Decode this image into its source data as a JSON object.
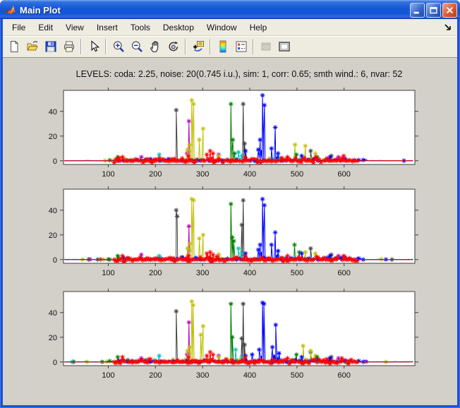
{
  "window": {
    "title": "Main Plot",
    "controls": [
      {
        "name": "minimize-button",
        "icon": "minimize-icon"
      },
      {
        "name": "maximize-button",
        "icon": "maximize-icon"
      },
      {
        "name": "close-button",
        "icon": "close-icon"
      }
    ]
  },
  "menu": {
    "items": [
      "File",
      "Edit",
      "View",
      "Insert",
      "Tools",
      "Desktop",
      "Window",
      "Help"
    ]
  },
  "toolbar": {
    "buttons": [
      {
        "name": "new-figure-button",
        "icon": "new-document-icon"
      },
      {
        "name": "open-file-button",
        "icon": "open-folder-icon"
      },
      {
        "name": "save-figure-button",
        "icon": "save-icon"
      },
      {
        "name": "print-figure-button",
        "icon": "print-icon"
      },
      {
        "separator": true
      },
      {
        "name": "edit-plot-button",
        "icon": "pointer-arrow-icon"
      },
      {
        "separator": true
      },
      {
        "name": "zoom-in-button",
        "icon": "zoom-in-icon"
      },
      {
        "name": "zoom-out-button",
        "icon": "zoom-out-icon"
      },
      {
        "name": "pan-button",
        "icon": "hand-icon"
      },
      {
        "name": "rotate-3d-button",
        "icon": "rotate-3d-icon"
      },
      {
        "separator": true
      },
      {
        "name": "data-cursor-button",
        "icon": "data-cursor-icon"
      },
      {
        "separator": true
      },
      {
        "name": "insert-colorbar-button",
        "icon": "colorbar-icon"
      },
      {
        "name": "insert-legend-button",
        "icon": "legend-icon"
      },
      {
        "separator": true
      },
      {
        "name": "hide-plot-tools-button",
        "icon": "hide-plot-tools-icon",
        "disabled": true
      },
      {
        "name": "show-plot-tools-button",
        "icon": "show-plot-tools-icon"
      }
    ]
  },
  "chart_data": {
    "type": "line",
    "title": "LEVELS: coda: 2.25, noise: 20(0.745 i.u.), sim: 1, corr: 0.65; smth wind.: 6, nvar: 52",
    "xlabel": "",
    "ylabel": "",
    "xlim": [
      5,
      750
    ],
    "ylim": [
      -3,
      57
    ],
    "xticks": [
      100,
      200,
      300,
      400,
      500,
      600
    ],
    "yticks": [
      0,
      20,
      40
    ],
    "grid": false,
    "legend": "none",
    "marker": "*",
    "series_order": [
      "gray",
      "magenta",
      "yellow",
      "green",
      "cyan",
      "blue",
      "red"
    ],
    "colors": {
      "gray": "#404040",
      "magenta": "#bf00bf",
      "yellow": "#bfbf00",
      "green": "#008000",
      "cyan": "#00bfbf",
      "blue": "#0000ff",
      "red": "#ff0000"
    },
    "noise": {
      "gray": {
        "band": [
          110,
          620
        ],
        "amp": 1.0,
        "base": 0.25,
        "every": 8
      },
      "magenta": {
        "band": [
          120,
          620
        ],
        "amp": 1.6,
        "base": 0.25,
        "every": 6
      },
      "yellow": {
        "band": [
          120,
          610
        ],
        "amp": 2.2,
        "base": 0.25,
        "every": 4
      },
      "green": {
        "band": [
          100,
          600
        ],
        "amp": 1.4,
        "base": 0.25,
        "every": 6
      },
      "cyan": {
        "band": [
          130,
          580
        ],
        "amp": 1.4,
        "base": 0.2,
        "every": 6
      },
      "blue": {
        "band": [
          120,
          650
        ],
        "amp": 2.0,
        "base": 0.3,
        "every": 3
      },
      "red": {
        "band": [
          110,
          630
        ],
        "amp": 2.4,
        "base": 0.25,
        "every": 1,
        "neg": true
      }
    },
    "subplots": [
      {
        "peaks": {
          "gray": [
            [
              244,
              41
            ],
            [
              386,
              46
            ],
            [
              389,
              14
            ],
            [
              529,
              8
            ],
            [
              573,
              4
            ]
          ],
          "magenta": [
            [
              271,
              32
            ],
            [
              267,
              6
            ],
            [
              334,
              5
            ],
            [
              170,
              3
            ],
            [
              588,
              3
            ]
          ],
          "yellow": [
            [
              268,
              9
            ],
            [
              273,
              13
            ],
            [
              277,
              49
            ],
            [
              281,
              46
            ],
            [
              293,
              17
            ],
            [
              301,
              26
            ],
            [
              334,
              4
            ],
            [
              496,
              13
            ],
            [
              518,
              12
            ],
            [
              539,
              6
            ]
          ],
          "green": [
            [
              120,
              3
            ],
            [
              360,
              46
            ],
            [
              364,
              17
            ],
            [
              368,
              6
            ],
            [
              499,
              5
            ],
            [
              543,
              3
            ]
          ],
          "cyan": [
            [
              208,
              5
            ],
            [
              376,
              7
            ],
            [
              383,
              4
            ],
            [
              460,
              3
            ]
          ],
          "blue": [
            [
              391,
              8
            ],
            [
              418,
              9
            ],
            [
              422,
              17
            ],
            [
              427,
              53
            ],
            [
              431,
              45
            ],
            [
              446,
              10
            ],
            [
              454,
              27
            ],
            [
              460,
              6
            ],
            [
              510,
              4
            ],
            [
              570,
              3
            ]
          ],
          "red": [
            [
              130,
              3
            ],
            [
              270,
              4
            ],
            [
              309,
              5
            ],
            [
              316,
              8
            ],
            [
              322,
              6
            ],
            [
              390,
              3
            ],
            [
              480,
              3
            ],
            [
              540,
              3
            ],
            [
              599,
              4
            ]
          ]
        }
      },
      {
        "peaks": {
          "gray": [
            [
              244,
              40
            ],
            [
              246,
              35
            ],
            [
              383,
              28
            ],
            [
              386,
              48
            ],
            [
              529,
              9
            ],
            [
              573,
              4
            ]
          ],
          "magenta": [
            [
              271,
              27
            ],
            [
              170,
              4
            ],
            [
              334,
              4
            ],
            [
              588,
              3
            ]
          ],
          "yellow": [
            [
              268,
              9
            ],
            [
              273,
              13
            ],
            [
              277,
              49
            ],
            [
              281,
              48
            ],
            [
              293,
              17
            ],
            [
              301,
              20
            ],
            [
              334,
              4
            ],
            [
              518,
              6
            ],
            [
              539,
              5
            ]
          ],
          "green": [
            [
              120,
              3
            ],
            [
              360,
              45
            ],
            [
              363,
              18
            ],
            [
              366,
              15
            ],
            [
              495,
              12
            ],
            [
              505,
              6
            ]
          ],
          "cyan": [
            [
              208,
              3
            ],
            [
              376,
              9
            ],
            [
              383,
              5
            ],
            [
              460,
              3
            ]
          ],
          "blue": [
            [
              391,
              5
            ],
            [
              418,
              8
            ],
            [
              422,
              12
            ],
            [
              427,
              49
            ],
            [
              431,
              44
            ],
            [
              446,
              12
            ],
            [
              454,
              22
            ],
            [
              460,
              7
            ],
            [
              510,
              5
            ],
            [
              570,
              3
            ]
          ],
          "red": [
            [
              130,
              3
            ],
            [
              270,
              3
            ],
            [
              309,
              5
            ],
            [
              316,
              6
            ],
            [
              322,
              4
            ],
            [
              390,
              3
            ],
            [
              480,
              3
            ],
            [
              599,
              3
            ]
          ]
        }
      },
      {
        "peaks": {
          "gray": [
            [
              244,
              41
            ],
            [
              383,
              19
            ],
            [
              386,
              47
            ],
            [
              389,
              14
            ],
            [
              529,
              8
            ],
            [
              573,
              4
            ]
          ],
          "magenta": [
            [
              271,
              32
            ],
            [
              267,
              6
            ],
            [
              334,
              5
            ],
            [
              170,
              3
            ],
            [
              588,
              3
            ]
          ],
          "yellow": [
            [
              268,
              9
            ],
            [
              273,
              12
            ],
            [
              277,
              49
            ],
            [
              280,
              46
            ],
            [
              296,
              22
            ],
            [
              301,
              29
            ],
            [
              334,
              4
            ],
            [
              513,
              13
            ],
            [
              529,
              9
            ],
            [
              539,
              5
            ]
          ],
          "green": [
            [
              120,
              4
            ],
            [
              360,
              47
            ],
            [
              363,
              20
            ],
            [
              499,
              6
            ],
            [
              543,
              4
            ]
          ],
          "cyan": [
            [
              208,
              5
            ],
            [
              370,
              10
            ],
            [
              383,
              4
            ],
            [
              460,
              3
            ]
          ],
          "blue": [
            [
              391,
              5
            ],
            [
              405,
              6
            ],
            [
              420,
              10
            ],
            [
              427,
              48
            ],
            [
              430,
              47
            ],
            [
              448,
              12
            ],
            [
              455,
              30
            ],
            [
              462,
              7
            ],
            [
              510,
              4
            ],
            [
              570,
              3
            ]
          ],
          "red": [
            [
              130,
              4
            ],
            [
              270,
              4
            ],
            [
              309,
              5
            ],
            [
              316,
              8
            ],
            [
              322,
              6
            ],
            [
              390,
              4
            ],
            [
              480,
              3
            ],
            [
              595,
              3
            ]
          ]
        }
      }
    ]
  }
}
